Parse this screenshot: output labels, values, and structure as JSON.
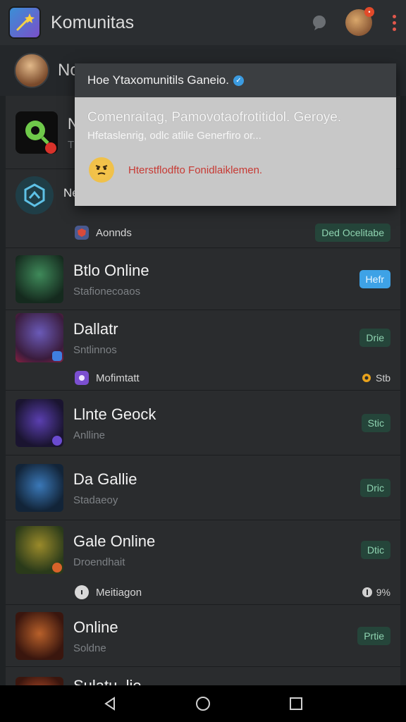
{
  "appbar": {
    "title": "Komunitas",
    "colors": {
      "bar": "#2b2e31",
      "accent": "#e2574c"
    }
  },
  "user": {
    "name": "No’ ... "
  },
  "popup": {
    "header": "Hoe Ytaxomunitils Ganeio.",
    "title": "Comenraitag, Pamovotaofrotitidol. Geroye.",
    "subtitle": "Hfetaslenrig, odlc atlile Generfiro or...",
    "warning": "Hterstflodfto Fonidlaiklemen."
  },
  "first_card": {
    "title_partial": "N",
    "sub_partial": "T"
  },
  "second_card": {
    "title_partial": "Ne",
    "meta_label": "Aonnds",
    "pill": "Ded Ocelitabe"
  },
  "games": [
    {
      "title": "Btlo Online",
      "sub": "Stafionecoaos",
      "pill": "Hefr",
      "pill_style": "blue"
    },
    {
      "title": "Dallatr",
      "sub": "Sntlinnos",
      "pill": "Drie",
      "pill_style": "green",
      "meta_label": "Mofimtatt",
      "meta_right": "Stb"
    },
    {
      "title": "Llnte Geock",
      "sub": "Anlline",
      "pill": "Stic",
      "pill_style": "green"
    },
    {
      "title": "Da Gallie",
      "sub": "Stadaeoy",
      "pill": "Dric",
      "pill_style": "green"
    },
    {
      "title": "Gale Online",
      "sub": "Droendhait",
      "pill": "Dtic",
      "pill_style": "green",
      "meta_label": "Meitiagon",
      "meta_right": "9%"
    },
    {
      "title": "Online",
      "sub": "Soldne",
      "pill": "Prtie",
      "pill_style": "green"
    },
    {
      "title": "Sulatu..lie",
      "sub": "",
      "pill": "",
      "pill_style": "green"
    }
  ]
}
